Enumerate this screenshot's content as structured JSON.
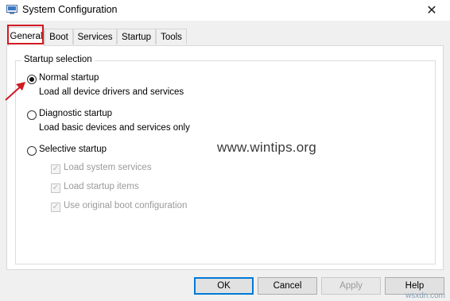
{
  "window": {
    "title": "System Configuration",
    "close_glyph": "✕"
  },
  "tabs": [
    {
      "label": "General",
      "active": true
    },
    {
      "label": "Boot"
    },
    {
      "label": "Services"
    },
    {
      "label": "Startup"
    },
    {
      "label": "Tools"
    }
  ],
  "startup_selection": {
    "legend": "Startup selection",
    "options": [
      {
        "label": "Normal startup",
        "description": "Load all device drivers and services",
        "selected": true
      },
      {
        "label": "Diagnostic startup",
        "description": "Load basic devices and services only",
        "selected": false
      },
      {
        "label": "Selective startup",
        "selected": false
      }
    ],
    "selective_items": [
      {
        "label": "Load system services",
        "checked": true,
        "enabled": false
      },
      {
        "label": "Load startup items",
        "checked": true,
        "enabled": false
      },
      {
        "label": "Use original boot configuration",
        "checked": true,
        "enabled": false
      }
    ]
  },
  "watermark": "www.wintips.org",
  "buttons": {
    "ok": "OK",
    "cancel": "Cancel",
    "apply": "Apply",
    "help": "Help"
  },
  "site_tag": "wsxdn.com",
  "colors": {
    "annotation_red": "#d11a22",
    "focus_blue": "#0078d7"
  },
  "icons": {
    "app": "system-config-icon",
    "close": "close-icon",
    "check": "checkmark-icon"
  }
}
